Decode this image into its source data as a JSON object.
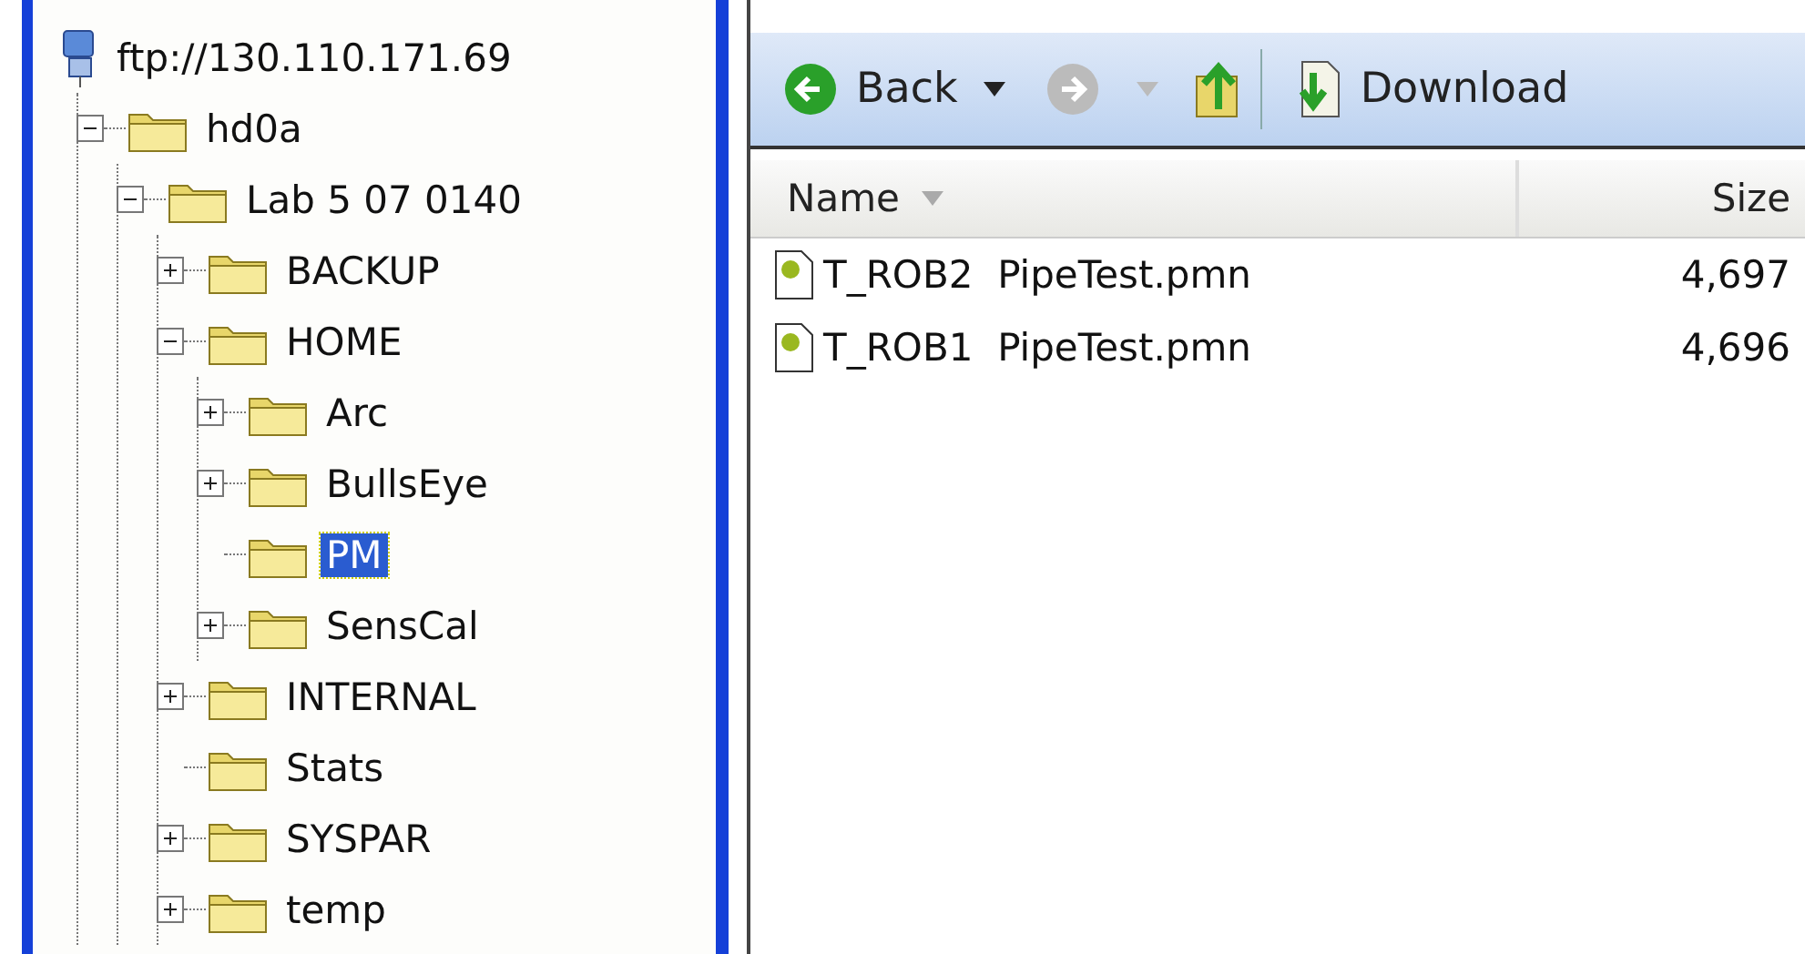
{
  "tree": {
    "label": "ftp://130.110.171.69",
    "kind": "server",
    "children": [
      {
        "label": "hd0a",
        "kind": "folder",
        "expanded": true,
        "selected": false,
        "children": [
          {
            "label": "Lab 5 07 0140",
            "kind": "folder",
            "expanded": true,
            "selected": false,
            "children": [
              {
                "label": "BACKUP",
                "kind": "folder",
                "expanded": false,
                "selected": false
              },
              {
                "label": "HOME",
                "kind": "folder",
                "expanded": true,
                "selected": false,
                "children": [
                  {
                    "label": "Arc",
                    "kind": "folder",
                    "expanded": false,
                    "selected": false
                  },
                  {
                    "label": "BullsEye",
                    "kind": "folder",
                    "expanded": false,
                    "selected": false
                  },
                  {
                    "label": "PM",
                    "kind": "folder",
                    "selected": true
                  },
                  {
                    "label": "SensCal",
                    "kind": "folder",
                    "expanded": false,
                    "selected": false
                  }
                ]
              },
              {
                "label": "INTERNAL",
                "kind": "folder",
                "expanded": false,
                "selected": false
              },
              {
                "label": "Stats",
                "kind": "folder",
                "selected": false
              },
              {
                "label": "SYSPAR",
                "kind": "folder",
                "expanded": false,
                "selected": false
              },
              {
                "label": "temp",
                "kind": "folder",
                "expanded": false,
                "selected": false
              }
            ]
          }
        ]
      }
    ]
  },
  "toolbar": {
    "back": "Back",
    "download": "Download"
  },
  "table": {
    "columns": [
      "Name",
      "Size"
    ],
    "rows": [
      {
        "name": "T_ROB2  PipeTest.pmn",
        "size": "4,697"
      },
      {
        "name": "T_ROB1  PipeTest.pmn",
        "size": "4,696"
      }
    ]
  }
}
